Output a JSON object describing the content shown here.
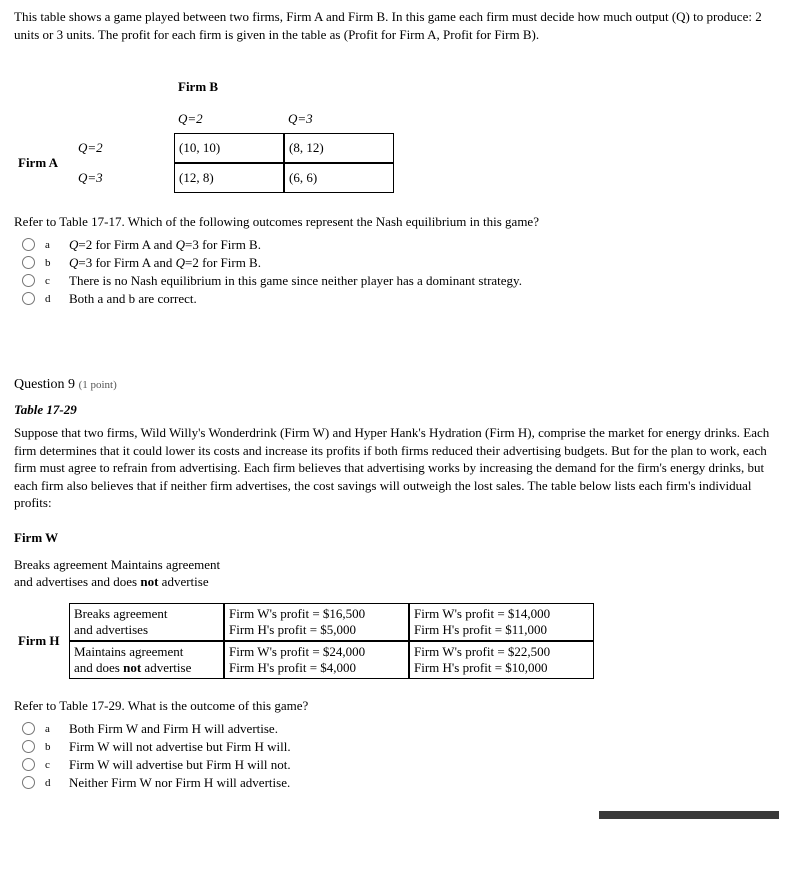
{
  "intro": {
    "line1": "This table shows a game played between two firms, Firm A and Firm B. In this game each firm must decide how much output (Q) to produce: 2 units or 3 units. The profit for each firm is given in the table as (Profit for Firm A, Profit for Firm B)."
  },
  "game1": {
    "firmA": "Firm A",
    "firmB": "Firm B",
    "rowLabels": [
      "Q=2",
      "Q=3"
    ],
    "colLabels": [
      "Q=2",
      "Q=3"
    ],
    "cells": [
      [
        "(10, 10)",
        "(8, 12)"
      ],
      [
        "(12, 8)",
        "(6, 6)"
      ]
    ]
  },
  "q8": {
    "prompt": "Refer to Table 17-17. Which of the following outcomes represent the Nash equilibrium in this game?",
    "opts": [
      {
        "letter": "a",
        "text": "Q=2 for Firm A and Q=3 for Firm B."
      },
      {
        "letter": "b",
        "text": "Q=3 for Firm A and Q=2 for Firm B."
      },
      {
        "letter": "c",
        "text": "There is no Nash equilibrium in this game since neither player has a dominant strategy."
      },
      {
        "letter": "d",
        "text": "Both a and b are correct."
      }
    ]
  },
  "q9": {
    "header": "Question 9",
    "points": "(1 point)",
    "tableTitle": "Table 17-29",
    "paragraph": "Suppose that two firms, Wild Willy's Wonderdrink (Firm W) and Hyper Hank's Hydration (Firm H), comprise the market for energy drinks. Each firm determines that it could lower its costs and increase its profits if both firms reduced their advertising budgets. But for the plan to work, each firm must agree to refrain from advertising. Each firm believes that advertising works by increasing the demand for the firm's energy drinks, but each firm also believes that if neither firm advertises, the cost savings will outweigh the lost sales. The table below lists each firm's individual profits:",
    "firmW": "Firm W",
    "firmH": "Firm H",
    "colHeadLine1": "Breaks agreement Maintains agreement",
    "colHeadLine2a": "and advertises and does ",
    "colHeadNot": "not",
    "colHeadLine2b": " advertise",
    "rowHeads": [
      {
        "l1": "Breaks agreement",
        "l2": "and advertises"
      },
      {
        "l1": "Maintains agreement",
        "l2a": "and does ",
        "not": "not",
        "l2b": " advertise"
      }
    ],
    "payoffs": [
      [
        {
          "w": "Firm W's profit = $16,500",
          "h": "Firm H's profit = $5,000"
        },
        {
          "w": "Firm W's profit = $14,000",
          "h": "Firm H's profit = $11,000"
        }
      ],
      [
        {
          "w": "Firm W's profit = $24,000",
          "h": "Firm H's profit = $4,000"
        },
        {
          "w": "Firm W's profit = $22,500",
          "h": "Firm H's profit = $10,000"
        }
      ]
    ],
    "prompt": "Refer to Table 17-29. What is the outcome of this game?",
    "opts": [
      {
        "letter": "a",
        "text": "Both Firm W and Firm H will advertise."
      },
      {
        "letter": "b",
        "text": "Firm W will not advertise but Firm H will."
      },
      {
        "letter": "c",
        "text": "Firm W will advertise but Firm H will not."
      },
      {
        "letter": "d",
        "text": "Neither Firm W nor Firm H will advertise."
      }
    ]
  },
  "chart_data": {
    "type": "table",
    "tables": [
      {
        "title": "Payoff matrix Firm A vs Firm B (Profit A, Profit B)",
        "row_player": "Firm A",
        "col_player": "Firm B",
        "row_strategies": [
          "Q=2",
          "Q=3"
        ],
        "col_strategies": [
          "Q=2",
          "Q=3"
        ],
        "payoffs": [
          [
            [
              10,
              10
            ],
            [
              8,
              12
            ]
          ],
          [
            [
              12,
              8
            ],
            [
              6,
              6
            ]
          ]
        ]
      },
      {
        "title": "Table 17-29 Advertising game Firm W vs Firm H (profits in $)",
        "row_player": "Firm H",
        "col_player": "Firm W",
        "row_strategies": [
          "Breaks agreement and advertises",
          "Maintains agreement and does not advertise"
        ],
        "col_strategies": [
          "Breaks agreement and advertises",
          "Maintains agreement and does not advertise"
        ],
        "payoffs_W": [
          [
            16500,
            14000
          ],
          [
            24000,
            22500
          ]
        ],
        "payoffs_H": [
          [
            5000,
            11000
          ],
          [
            4000,
            10000
          ]
        ]
      }
    ]
  }
}
